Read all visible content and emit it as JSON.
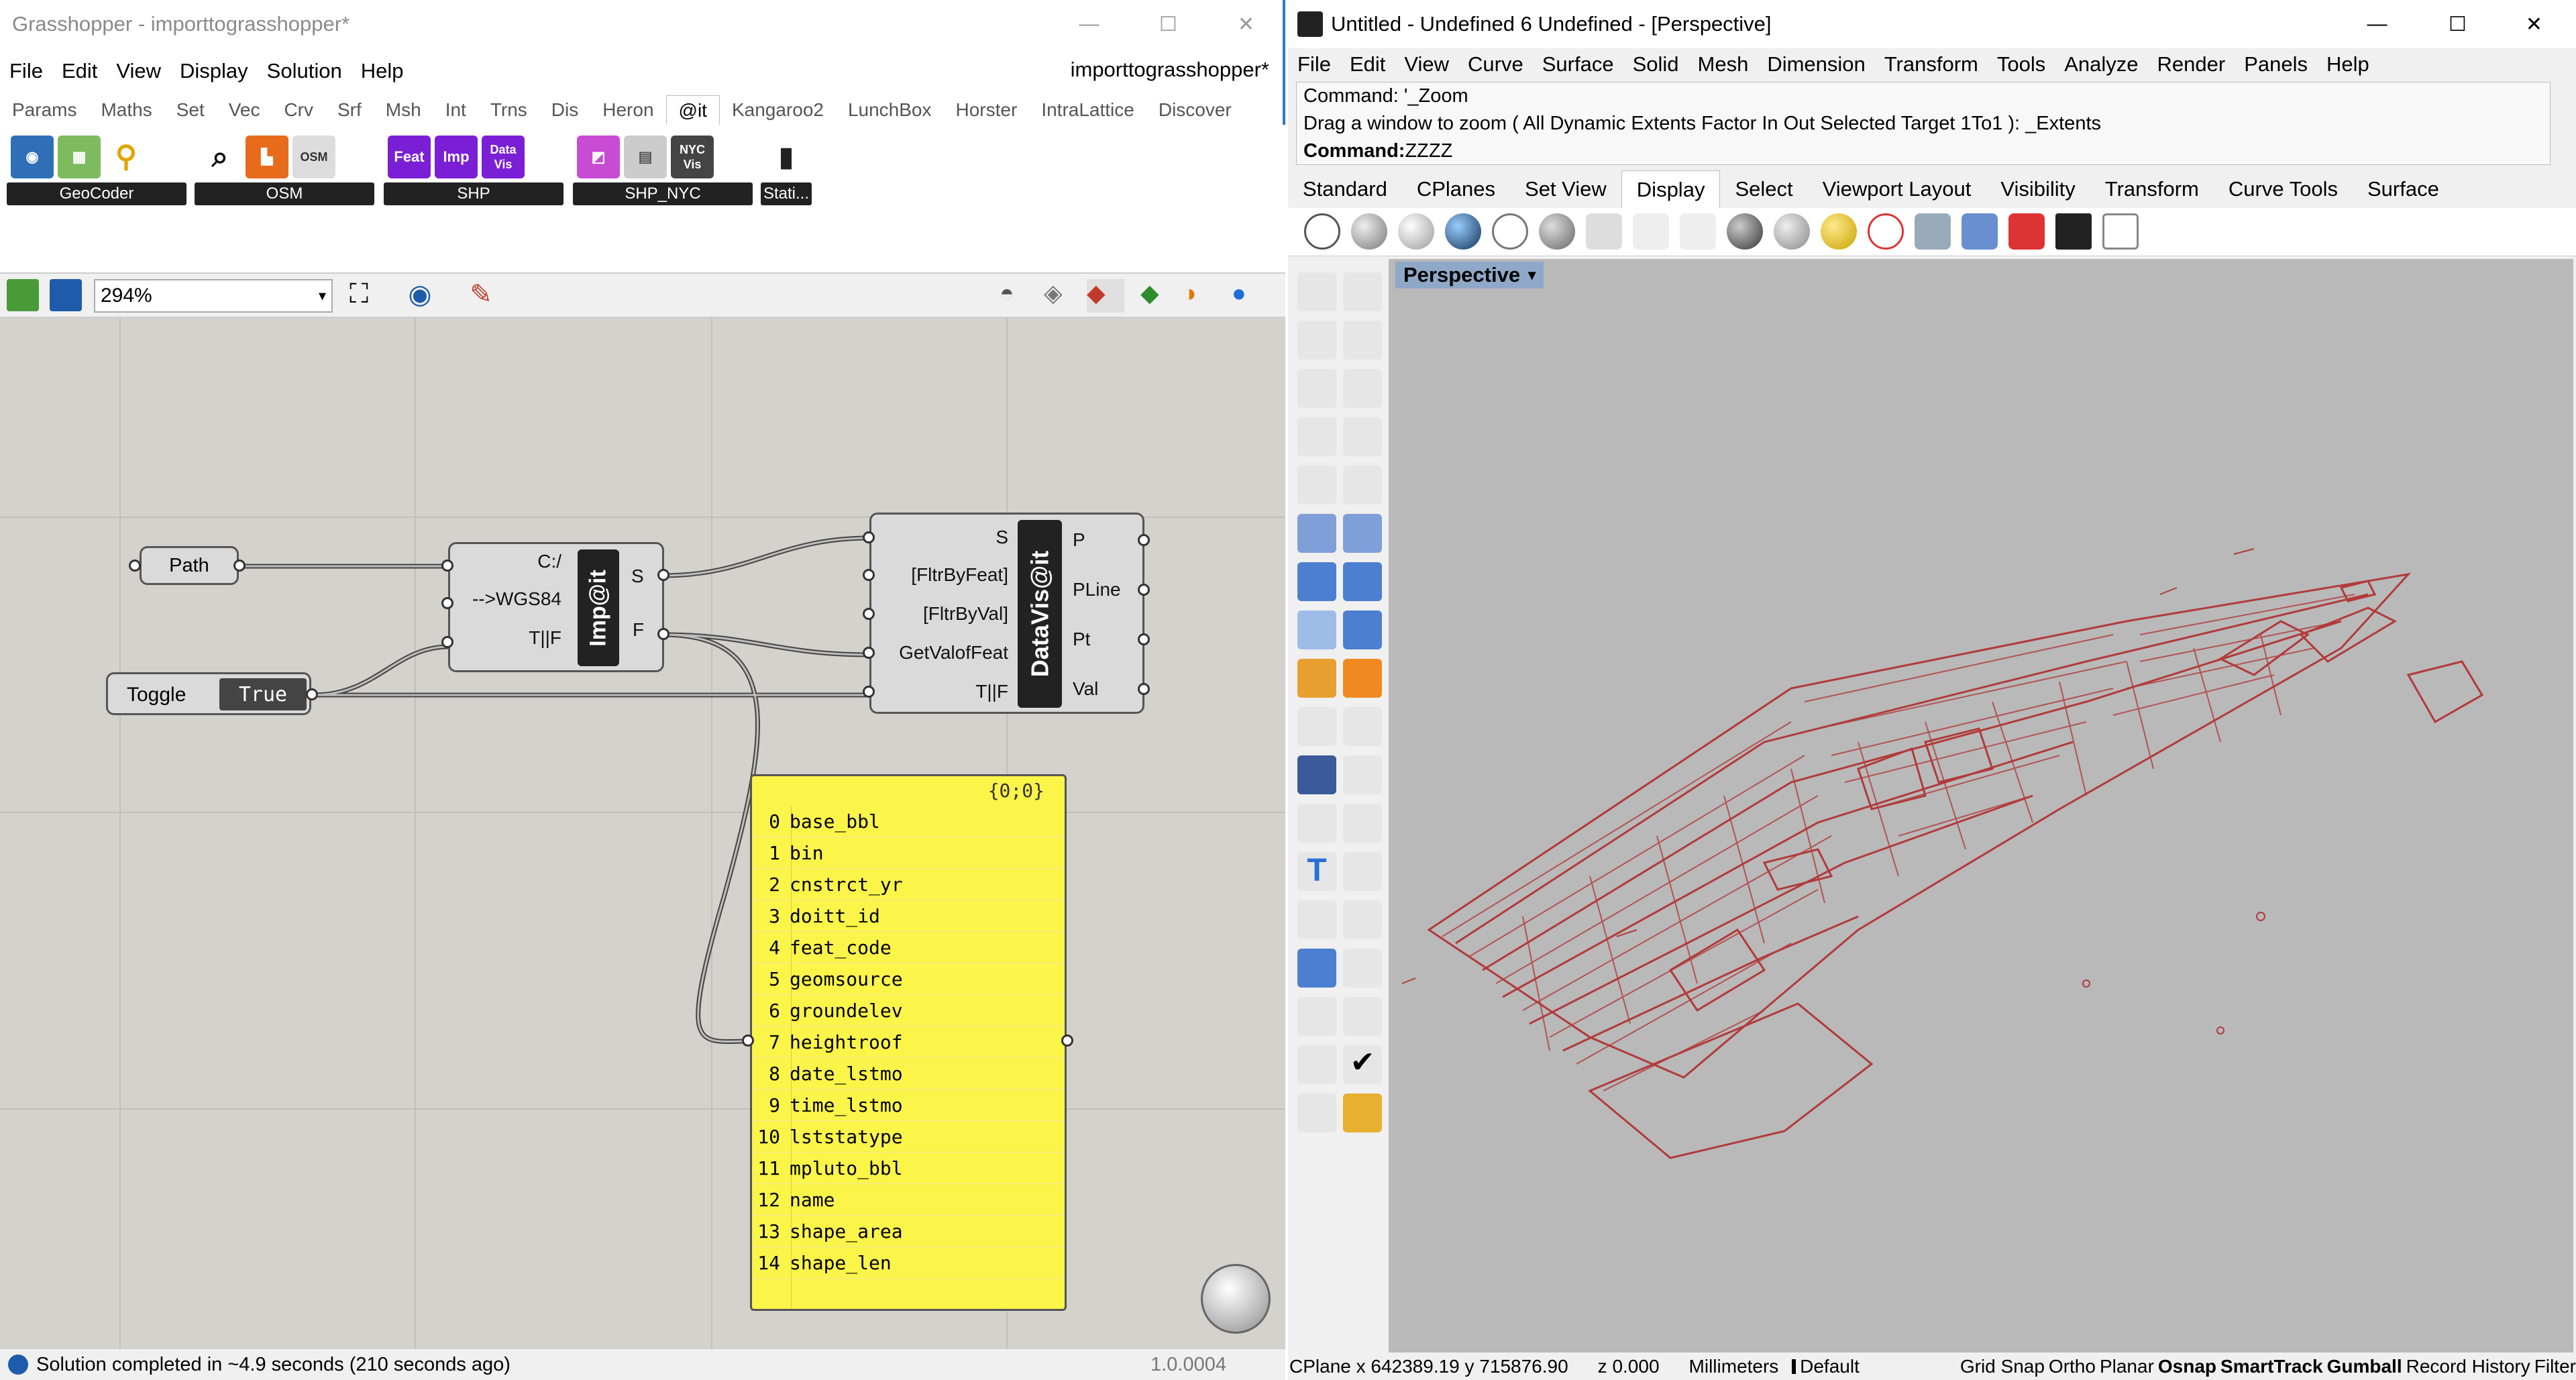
{
  "gh": {
    "title": "Grasshopper - importtograsshopper*",
    "menu": [
      "File",
      "Edit",
      "View",
      "Display",
      "Solution",
      "Help"
    ],
    "doc_name": "importtograsshopper*",
    "tabs": [
      "Params",
      "Maths",
      "Set",
      "Vec",
      "Crv",
      "Srf",
      "Msh",
      "Int",
      "Trns",
      "Dis",
      "Heron",
      "@it",
      "Kangaroo2",
      "LunchBox",
      "Horster",
      "IntraLattice",
      "Discover"
    ],
    "active_tab": "@it",
    "ribbon_groups": [
      "GeoCoder",
      "OSM",
      "SHP",
      "SHP_NYC",
      "Stati..."
    ],
    "zoom": "294%",
    "canvas": {
      "path_param": "Path",
      "toggle_label": "Toggle",
      "toggle_value": "True",
      "imp_name": "Imp@it",
      "imp_inputs": [
        "C:/",
        "-->WGS84",
        "T||F"
      ],
      "imp_outputs": [
        "S",
        "F"
      ],
      "dv_name": "DataVis@it",
      "dv_inputs": [
        "S",
        "[FltrByFeat]",
        "[FltrByVal]",
        "GetValofFeat",
        "T||F"
      ],
      "dv_outputs": [
        "P",
        "PLine",
        "Pt",
        "Val"
      ],
      "panel_header": "{0;0}",
      "panel_items": [
        "base_bbl",
        "bin",
        "cnstrct_yr",
        "doitt_id",
        "feat_code",
        "geomsource",
        "groundelev",
        "heightroof",
        "date_lstmo",
        "time_lstmo",
        "lststatype",
        "mpluto_bbl",
        "name",
        "shape_area",
        "shape_len"
      ]
    },
    "status": "Solution completed in ~4.9 seconds (210 seconds ago)",
    "version": "1.0.0004"
  },
  "rhino": {
    "title": "Untitled - Undefined 6 Undefined - [Perspective]",
    "menu": [
      "File",
      "Edit",
      "View",
      "Curve",
      "Surface",
      "Solid",
      "Mesh",
      "Dimension",
      "Transform",
      "Tools",
      "Analyze",
      "Render",
      "Panels",
      "Help"
    ],
    "cmd_history": [
      "Command: '_Zoom",
      "Drag a window to zoom ( All  Dynamic  Extents  Factor  In  Out  Selected  Target  1To1 ): _Extents"
    ],
    "cmd_label": "Command:",
    "cmd_value": "ZZZZ",
    "tabs": [
      "Standard",
      "CPlanes",
      "Set View",
      "Display",
      "Select",
      "Viewport Layout",
      "Visibility",
      "Transform",
      "Curve Tools",
      "Surface"
    ],
    "active_tab": "Display",
    "viewport_label": "Perspective",
    "status": {
      "coords": "CPlane x 642389.19 y 715876.90",
      "z": "z 0.000",
      "units": "Millimeters",
      "layer": "Default",
      "snaps": [
        "Grid Snap",
        "Ortho",
        "Planar",
        "Osnap",
        "SmartTrack",
        "Gumball",
        "Record History",
        "Filter"
      ]
    }
  },
  "colors": {
    "accent": "#2b79d6",
    "panel": "#fbf449",
    "curves": "#b23a3a",
    "viewport": "#b9b9b9"
  }
}
